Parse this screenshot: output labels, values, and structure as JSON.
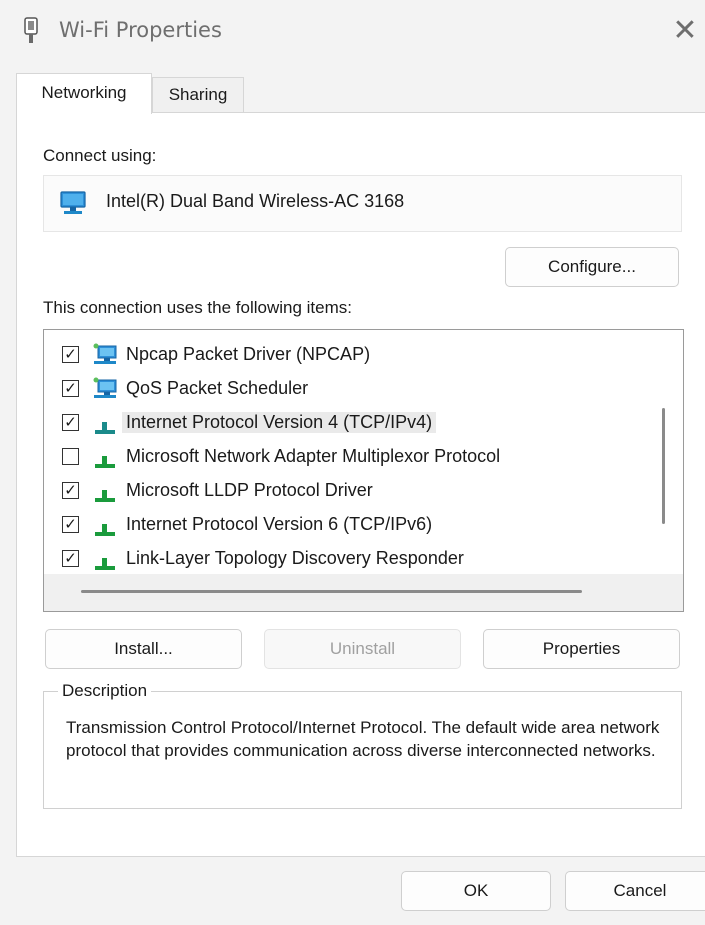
{
  "window": {
    "title": "Wi-Fi Properties",
    "close_glyph": "✕",
    "title_icon": "network-adapter-icon"
  },
  "tabs": [
    {
      "label": "Networking",
      "active": true
    },
    {
      "label": "Sharing",
      "active": false
    }
  ],
  "connect_using": {
    "label": "Connect using:",
    "adapter_name": "Intel(R) Dual Band Wireless-AC 3168",
    "adapter_icon": "network-adapter-icon"
  },
  "configure_label": "Configure...",
  "items_label": "This connection uses the following items:",
  "items": [
    {
      "label": "Npcap Packet Driver (NPCAP)",
      "checked": true,
      "icon": "network-client-icon"
    },
    {
      "label": "QoS Packet Scheduler",
      "checked": true,
      "icon": "network-client-icon"
    },
    {
      "label": "Internet Protocol Version 4 (TCP/IPv4)",
      "checked": true,
      "icon": "protocol-icon",
      "selected": true
    },
    {
      "label": "Microsoft Network Adapter Multiplexor Protocol",
      "checked": false,
      "icon": "protocol-icon"
    },
    {
      "label": "Microsoft LLDP Protocol Driver",
      "checked": true,
      "icon": "protocol-icon"
    },
    {
      "label": "Internet Protocol Version 6 (TCP/IPv6)",
      "checked": true,
      "icon": "protocol-icon"
    },
    {
      "label": "Link-Layer Topology Discovery Responder",
      "checked": true,
      "icon": "protocol-icon"
    }
  ],
  "buttons": {
    "install": "Install...",
    "uninstall": "Uninstall",
    "properties": "Properties",
    "ok": "OK",
    "cancel": "Cancel"
  },
  "description": {
    "legend": "Description",
    "text": "Transmission Control Protocol/Internet Protocol. The default wide area network protocol that provides communication across diverse interconnected networks."
  },
  "colors": {
    "protocol_icon": "#1a9b3c",
    "protocol_icon_selected": "#1a8a8a",
    "monitor_icon": "#1e88c8"
  }
}
